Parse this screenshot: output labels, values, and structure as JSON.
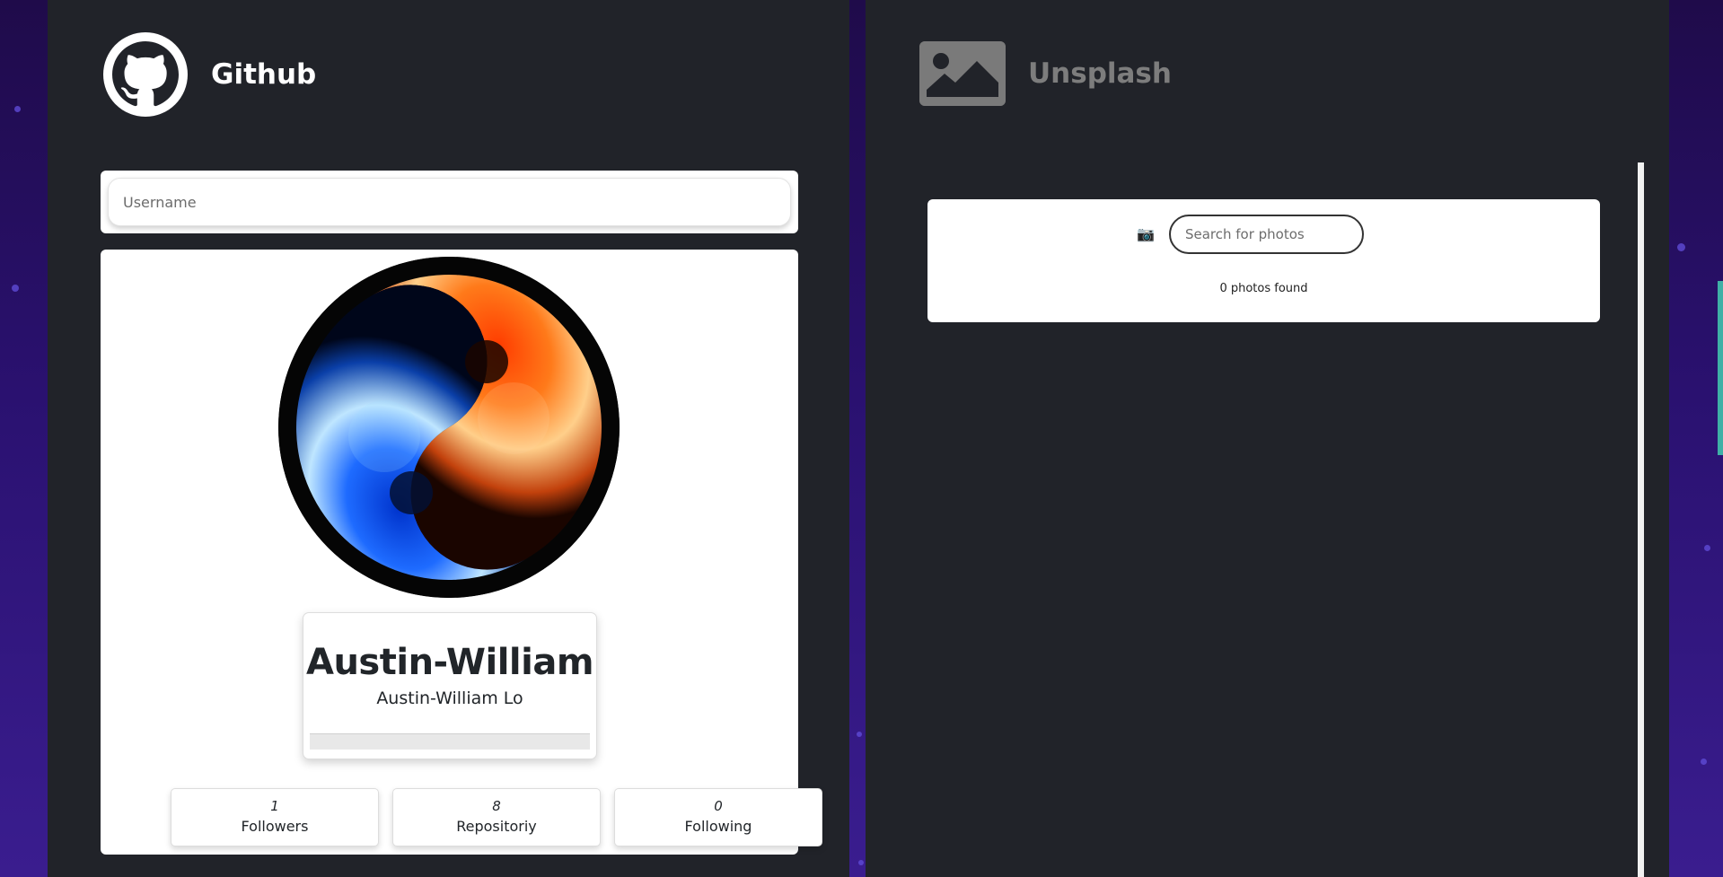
{
  "github": {
    "title": "Github",
    "username_placeholder": "Username",
    "login": "Austin-William",
    "name": "Austin-William Lo",
    "stats": {
      "followers_count": "1",
      "followers_label": "Followers",
      "repos_count": "8",
      "repos_label": "Repositoriy",
      "following_count": "0",
      "following_label": "Following"
    }
  },
  "unsplash": {
    "title": "Unsplash",
    "search_placeholder": "Search for photos",
    "camera_icon": "📷",
    "photos_found": "0 photos found"
  },
  "colors": {
    "panel_bg": "#212329",
    "background": "#2a1170",
    "accent": "#3fb0a6"
  }
}
